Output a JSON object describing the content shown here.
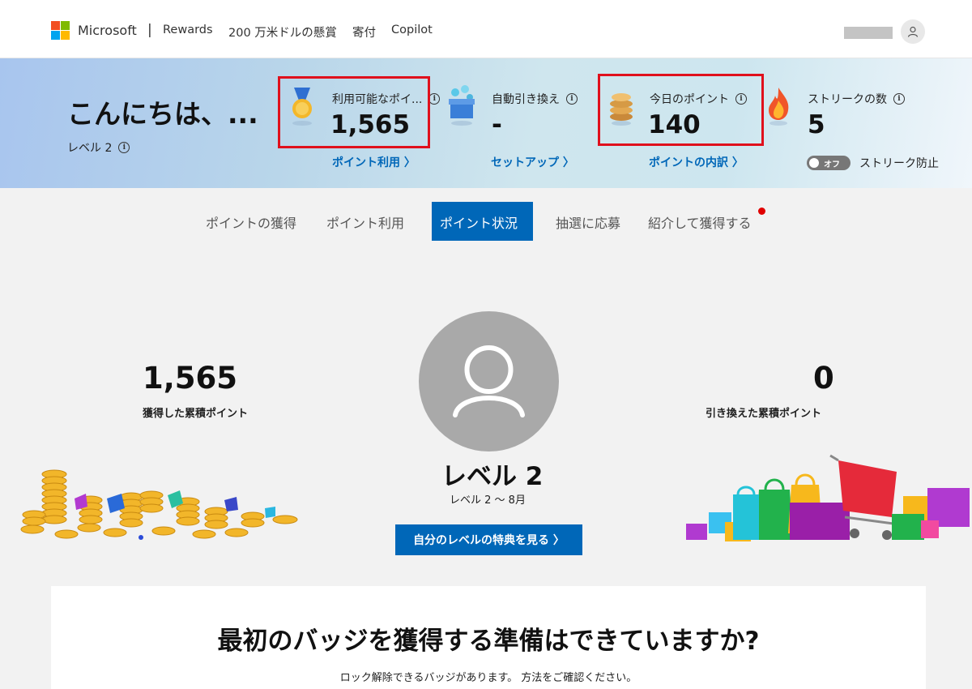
{
  "brand": {
    "name": "Microsoft",
    "separator": "|"
  },
  "nav": {
    "links": [
      "Rewards",
      "200 万米ドルの懸賞",
      "寄付",
      "Copilot"
    ]
  },
  "hero": {
    "greeting": "こんにちは、...",
    "level": "レベル 2",
    "stats": [
      {
        "label": "利用可能なポイ...",
        "value": "1,565",
        "link": "ポイント利用 〉",
        "icon": "medal-icon"
      },
      {
        "label": "自動引き換え",
        "value": "-",
        "link": "セットアップ 〉",
        "icon": "gift-box-icon"
      },
      {
        "label": "今日のポイント",
        "value": "140",
        "link": "ポイントの内訳 〉",
        "icon": "coin-stack-icon"
      },
      {
        "label": "ストリークの数",
        "value": "5",
        "icon": "flame-icon"
      }
    ],
    "toggle_label": "オフ",
    "streak_protect": "ストリーク防止"
  },
  "tabs": [
    "ポイントの獲得",
    "ポイント利用",
    "ポイント状況",
    "抽選に応募",
    "紹介して獲得する"
  ],
  "active_tab": "ポイント状況",
  "status": {
    "earned_value": "1,565",
    "earned_caption": "獲得した累積ポイント",
    "redeemed_value": "0",
    "redeemed_caption": "引き換えた累積ポイント",
    "level_title": "レベル 2",
    "level_sub": "レベル 2 〜 8月",
    "perk_button": "自分のレベルの特典を見る 〉"
  },
  "badge_card": {
    "title": "最初のバッジを獲得する準備はできていますか?",
    "subtitle": "ロック解除できるバッジがあります。 方法をご確認ください。"
  },
  "colors": {
    "accent": "#0067b8",
    "highlight": "#e0101c",
    "notification": "#e00000"
  }
}
